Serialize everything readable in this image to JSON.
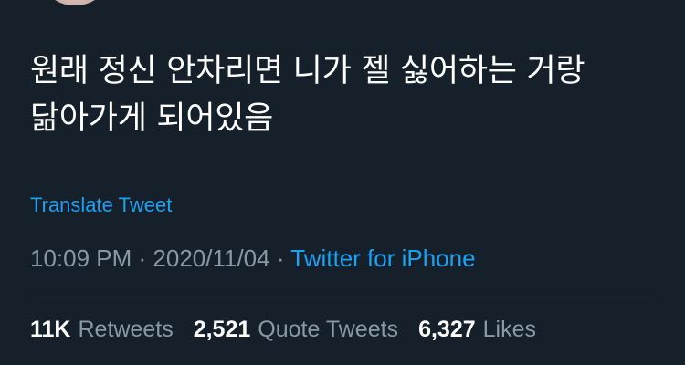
{
  "tweet": {
    "text": "원래 정신 안차리면 니가 젤 싫어하는 거랑\n닮아가게 되어있음",
    "translate_label": "Translate Tweet",
    "time": "10:09 PM",
    "separator1": " · ",
    "date": "2020/11/04",
    "separator2": " · ",
    "source": "Twitter for iPhone"
  },
  "stats": {
    "retweets_count": "11K",
    "retweets_label": "Retweets",
    "quotes_count": "2,521",
    "quotes_label": "Quote Tweets",
    "likes_count": "6,327",
    "likes_label": "Likes"
  },
  "colors": {
    "background": "#15202b",
    "link": "#1da1f2",
    "muted": "#8899a6",
    "divider": "#38444d"
  }
}
